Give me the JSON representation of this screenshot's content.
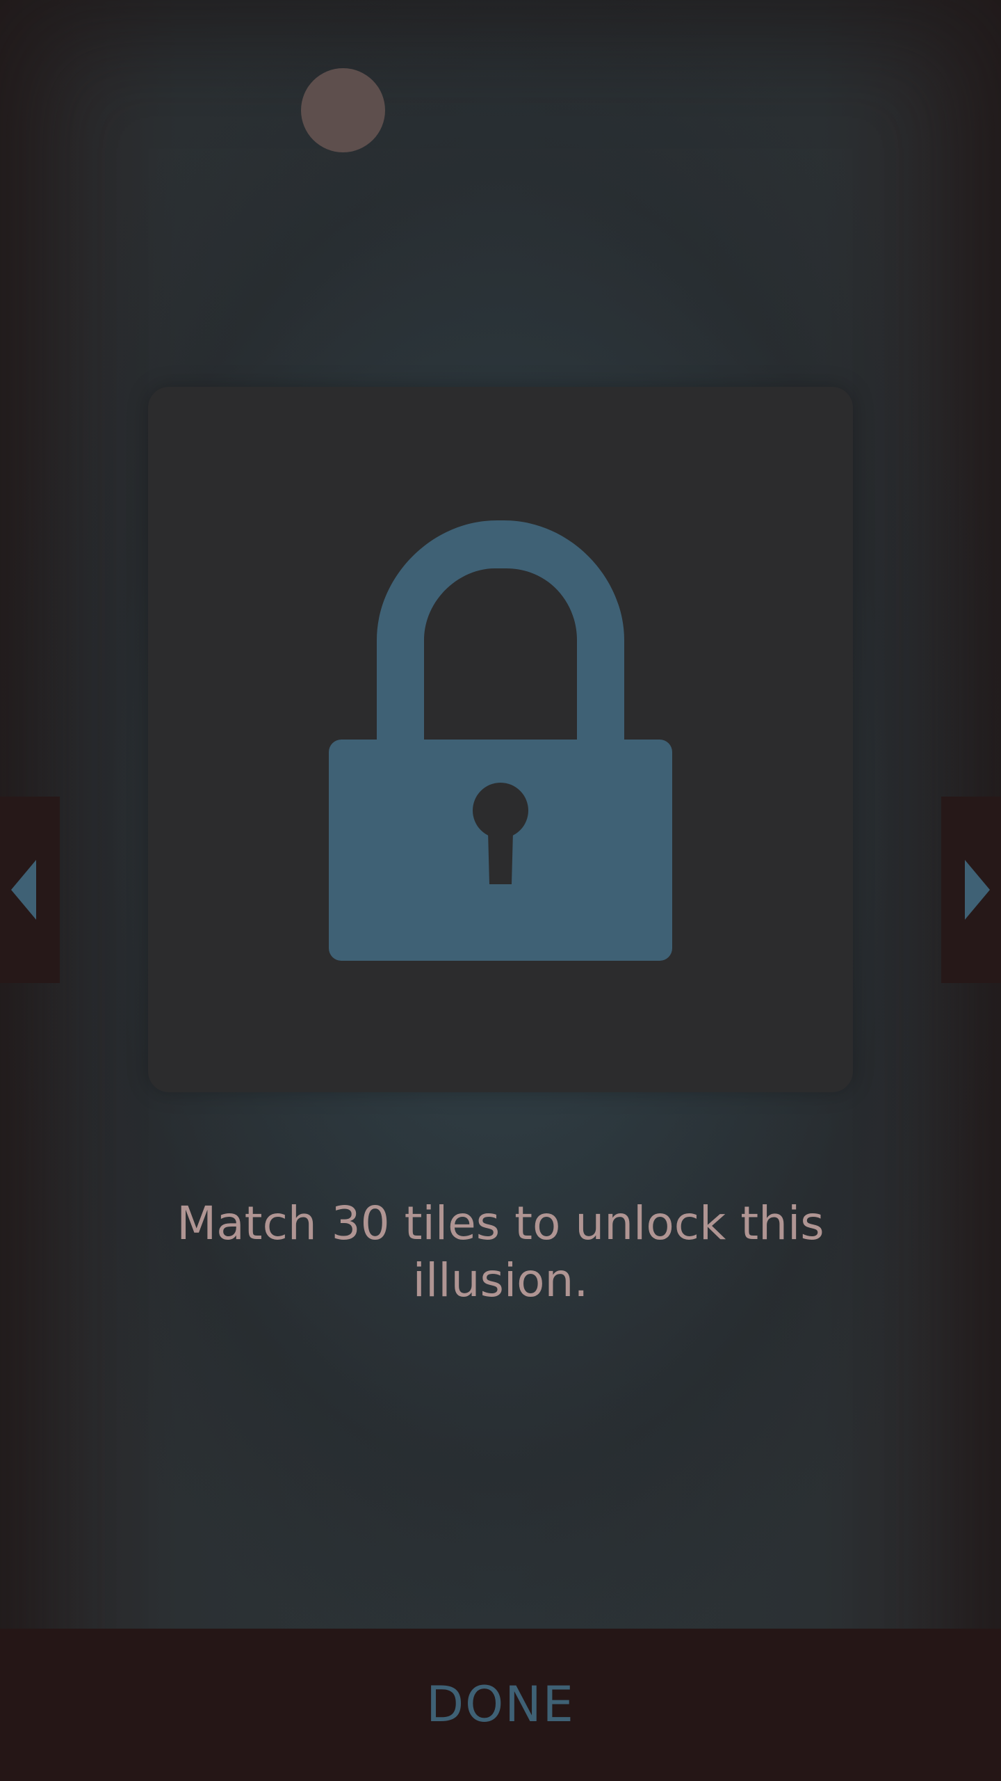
{
  "colors": {
    "page_dot": "#5e4f4d",
    "lock": "#3f6175",
    "arrow": "#3f6175",
    "done_text": "#3f6175",
    "message_text": "#b09593"
  },
  "pager": {
    "dot_count": 1,
    "active_index": 0
  },
  "card": {
    "icon": "lock-icon",
    "locked": true
  },
  "navigation": {
    "prev_icon": "chevron-left-icon",
    "next_icon": "chevron-right-icon"
  },
  "unlock_message": "Match 30 tiles to unlock this illusion.",
  "footer": {
    "done_label": "DONE"
  }
}
